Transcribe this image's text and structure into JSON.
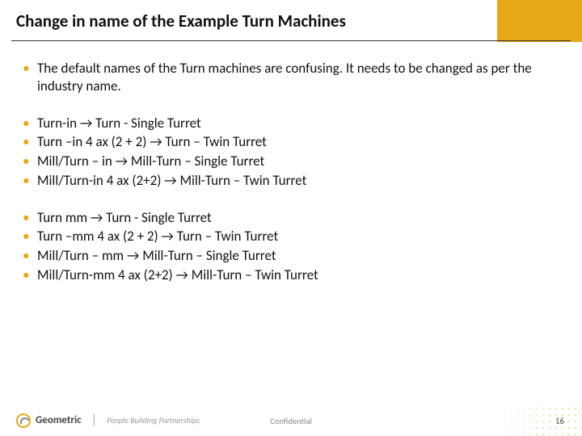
{
  "title": "Change in name of the Example Turn Machines",
  "intro": "The default names of the Turn machines are confusing. It needs to be changed as per the industry name.",
  "group1": [
    "Turn-in → Turn - Single Turret",
    "Turn –in 4 ax (2 + 2) → Turn – Twin Turret",
    "Mill/Turn – in → Mill-Turn – Single Turret",
    "Mill/Turn-in 4 ax  (2+2) → Mill-Turn – Twin Turret"
  ],
  "group2": [
    "Turn mm → Turn - Single Turret",
    "Turn –mm 4 ax (2 + 2) → Turn – Twin Turret",
    "Mill/Turn – mm → Mill-Turn – Single Turret",
    "Mill/Turn-mm 4 ax  (2+2) → Mill-Turn – Twin Turret"
  ],
  "footer": {
    "brand": "Geometric",
    "tagline": "People Building Partnerships",
    "center": "Confidential",
    "page": "16"
  }
}
